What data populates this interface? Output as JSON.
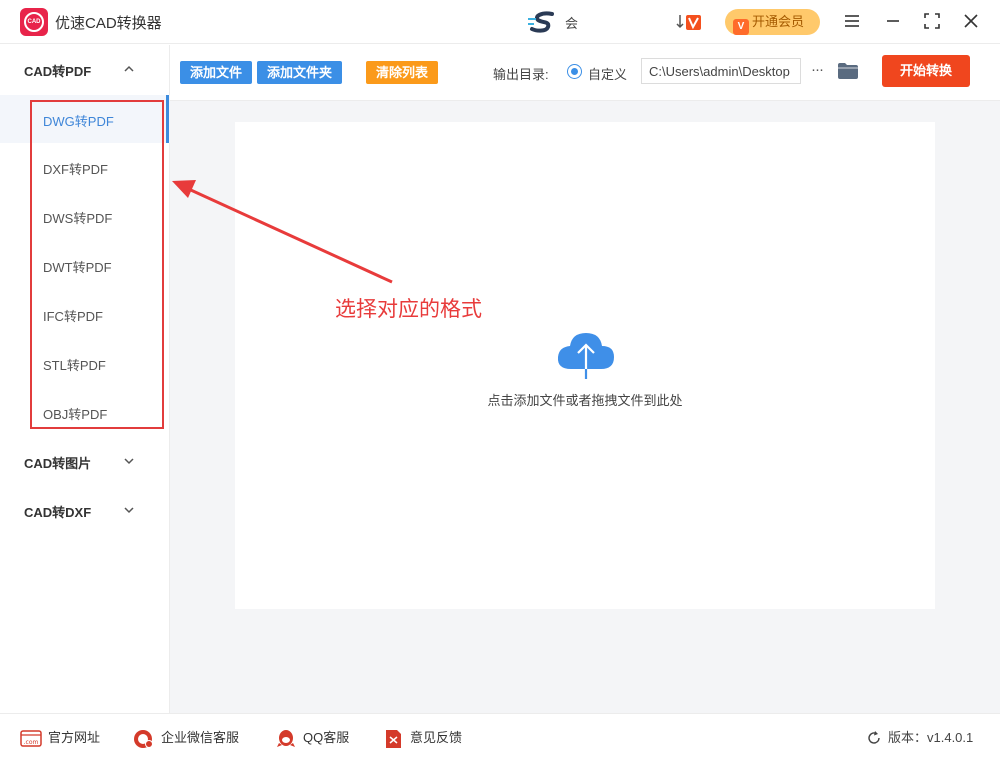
{
  "app": {
    "logo_text": "CAD",
    "title": "优速CAD转换器",
    "hui_label": "会",
    "vip_button": "开通会员",
    "vip_icon_letter": "V"
  },
  "sidebar": {
    "groups": [
      {
        "label": "CAD转PDF",
        "expanded": true,
        "items": [
          {
            "label": "DWG转PDF",
            "active": true
          },
          {
            "label": "DXF转PDF"
          },
          {
            "label": "DWS转PDF"
          },
          {
            "label": "DWT转PDF"
          },
          {
            "label": "IFC转PDF"
          },
          {
            "label": "STL转PDF"
          },
          {
            "label": "OBJ转PDF"
          }
        ]
      },
      {
        "label": "CAD转图片",
        "expanded": false
      },
      {
        "label": "CAD转DXF",
        "expanded": false
      }
    ]
  },
  "toolbar": {
    "add_file": "添加文件",
    "add_folder": "添加文件夹",
    "clear_list": "清除列表",
    "output_label": "输出目录:",
    "radio_label": "自定义",
    "output_path": "C:\\Users\\admin\\Desktop",
    "more": "···",
    "start": "开始转换"
  },
  "main": {
    "drop_hint": "点击添加文件或者拖拽文件到此处"
  },
  "annotation": {
    "text": "选择对应的格式"
  },
  "footer": {
    "website": "官方网址",
    "website_icon_text": ".com",
    "wechat": "企业微信客服",
    "qq": "QQ客服",
    "feedback": "意见反馈",
    "version": "版本：v1.4.0.1"
  },
  "colors": {
    "primary_blue": "#3b8fe6",
    "orange": "#fb9a1a",
    "start_red": "#f0461e",
    "annotation_red": "#e83b3b",
    "vip_gold": "#ffc96b"
  }
}
